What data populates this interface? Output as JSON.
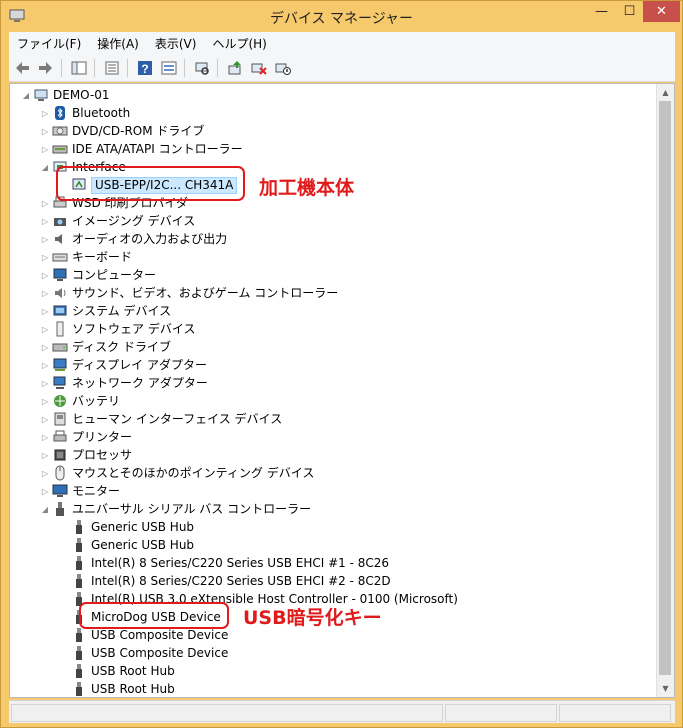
{
  "window": {
    "title": "デバイス マネージャー",
    "minimize_icon": "minimize-icon",
    "maximize_icon": "maximize-icon",
    "close_icon": "close-icon",
    "close_symbol": "✕",
    "minimize_symbol": "—",
    "maximize_symbol": "☐"
  },
  "menu": [
    {
      "label": "ファイル(F)"
    },
    {
      "label": "操作(A)"
    },
    {
      "label": "表示(V)"
    },
    {
      "label": "ヘルプ(H)"
    }
  ],
  "toolbar": [
    "back-icon",
    "forward-icon",
    "properties-icon",
    "view-icon",
    "help-icon",
    "resources-icon",
    "scan-hardware-icon",
    "update-driver-icon",
    "uninstall-icon",
    "disable-device-icon"
  ],
  "tree": {
    "root": "DEMO-01",
    "categories": [
      {
        "label": "Bluetooth",
        "icon": "bluetooth-icon"
      },
      {
        "label": "DVD/CD-ROM ドライブ",
        "icon": "dvd-drive-icon"
      },
      {
        "label": "IDE ATA/ATAPI コントローラー",
        "icon": "ide-controller-icon"
      },
      {
        "label": "Interface",
        "icon": "interface-icon",
        "expanded": true,
        "children": [
          {
            "label": "USB-EPP/I2C... CH341A",
            "icon": "usb-interface-icon",
            "selected": true
          }
        ]
      },
      {
        "label": "WSD 印刷プロバイダ",
        "icon": "printer-provider-icon"
      },
      {
        "label": "イメージング デバイス",
        "icon": "camera-icon"
      },
      {
        "label": "オーディオの入力および出力",
        "icon": "speaker-icon"
      },
      {
        "label": "キーボード",
        "icon": "keyboard-icon"
      },
      {
        "label": "コンピューター",
        "icon": "computer-icon"
      },
      {
        "label": "サウンド、ビデオ、およびゲーム コントローラー",
        "icon": "sound-icon"
      },
      {
        "label": "システム デバイス",
        "icon": "system-device-icon"
      },
      {
        "label": "ソフトウェア デバイス",
        "icon": "software-device-icon"
      },
      {
        "label": "ディスク ドライブ",
        "icon": "disk-drive-icon"
      },
      {
        "label": "ディスプレイ アダプター",
        "icon": "display-adapter-icon"
      },
      {
        "label": "ネットワーク アダプター",
        "icon": "network-adapter-icon"
      },
      {
        "label": "バッテリ",
        "icon": "battery-icon"
      },
      {
        "label": "ヒューマン インターフェイス デバイス",
        "icon": "hid-icon"
      },
      {
        "label": "プリンター",
        "icon": "printer-icon"
      },
      {
        "label": "プロセッサ",
        "icon": "processor-icon"
      },
      {
        "label": "マウスとそのほかのポインティング デバイス",
        "icon": "mouse-icon"
      },
      {
        "label": "モニター",
        "icon": "monitor-icon"
      },
      {
        "label": "ユニバーサル シリアル バス コントローラー",
        "icon": "usb-controller-icon",
        "expanded": true,
        "children": [
          {
            "label": "Generic USB Hub",
            "icon": "usb-plug-icon"
          },
          {
            "label": "Generic USB Hub",
            "icon": "usb-plug-icon"
          },
          {
            "label": "Intel(R) 8 Series/C220 Series USB EHCI #1 - 8C26",
            "icon": "usb-plug-icon"
          },
          {
            "label": "Intel(R) 8 Series/C220 Series USB EHCI #2 - 8C2D",
            "icon": "usb-plug-icon"
          },
          {
            "label": "Intel(R) USB 3.0 eXtensible Host Controller - 0100 (Microsoft)",
            "icon": "usb-plug-icon"
          },
          {
            "label": "MicroDog USB Device",
            "icon": "usb-plug-icon"
          },
          {
            "label": "USB Composite Device",
            "icon": "usb-plug-icon"
          },
          {
            "label": "USB Composite Device",
            "icon": "usb-plug-icon"
          },
          {
            "label": "USB Root Hub",
            "icon": "usb-plug-icon"
          },
          {
            "label": "USB Root Hub",
            "icon": "usb-plug-icon"
          }
        ]
      }
    ]
  },
  "annotations": [
    {
      "text": "加工機本体"
    },
    {
      "text": "USB暗号化キー"
    }
  ],
  "colors": {
    "annotation": "#e01b1b",
    "selection": "#cce8ff",
    "window_frame": "#f6c96c"
  },
  "symbols": {
    "collapsed": "▷",
    "expanded": "◢",
    "scroll_up": "▲",
    "scroll_down": "▼"
  }
}
